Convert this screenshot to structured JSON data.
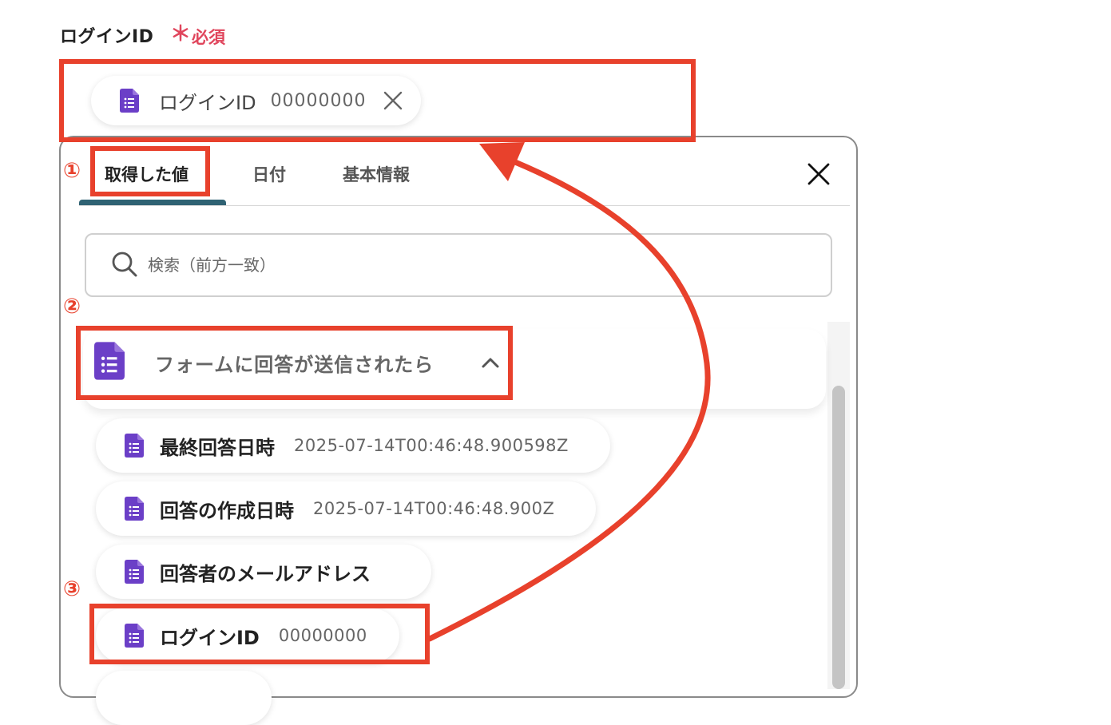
{
  "field": {
    "label": "ログインID",
    "required_mark": "＊",
    "required_text": "必須",
    "selected_chip": {
      "label": "ログインID",
      "value": "00000000"
    }
  },
  "panel": {
    "tabs": [
      {
        "label": "取得した値",
        "active": true
      },
      {
        "label": "日付"
      },
      {
        "label": "基本情報"
      }
    ],
    "search_placeholder": "検索（前方一致）",
    "group": {
      "title": "フォームに回答が送信されたら",
      "items": [
        {
          "label": "最終回答日時",
          "value": "2025-07-14T00:46:48.900598Z"
        },
        {
          "label": "回答の作成日時",
          "value": "2025-07-14T00:46:48.900Z"
        },
        {
          "label": "回答者のメールアドレス",
          "value": ""
        },
        {
          "label": "ログインID",
          "value": "00000000"
        }
      ]
    }
  },
  "annotations": {
    "step1": "①",
    "step2": "②",
    "step3": "③"
  },
  "colors": {
    "accent_red": "#e8412c",
    "required_pink": "#e0455c",
    "icon_purple": "#6b3fc7",
    "tab_underline": "#2f6273"
  },
  "icons": {
    "doc": "google-forms-doc-icon",
    "close": "close-icon",
    "search": "search-icon",
    "chevron": "chevron-up-icon"
  }
}
